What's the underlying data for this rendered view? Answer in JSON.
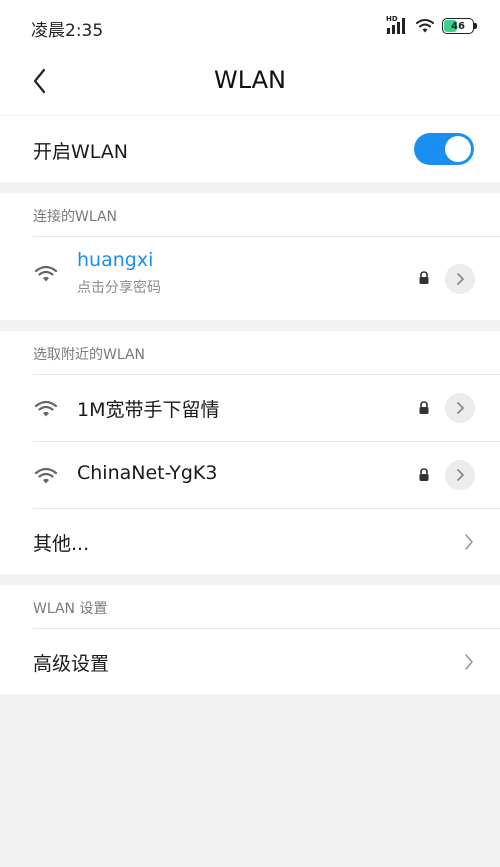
{
  "status": {
    "time": "凌晨2:35",
    "network": "HD",
    "battery": "46"
  },
  "header": {
    "title": "WLAN"
  },
  "wlan_toggle": {
    "label": "开启WLAN",
    "enabled": true
  },
  "connected": {
    "section_title": "连接的WLAN",
    "network": {
      "name": "huangxi",
      "subtitle": "点击分享密码"
    }
  },
  "nearby": {
    "section_title": "选取附近的WLAN",
    "networks": [
      {
        "name": "1M宽带手下留情"
      },
      {
        "name": "ChinaNet-YgK3"
      }
    ],
    "other_label": "其他..."
  },
  "settings": {
    "section_title": "WLAN 设置",
    "advanced_label": "高级设置"
  },
  "colors": {
    "accent": "#1b8ff1",
    "background": "#f2f2f2"
  }
}
